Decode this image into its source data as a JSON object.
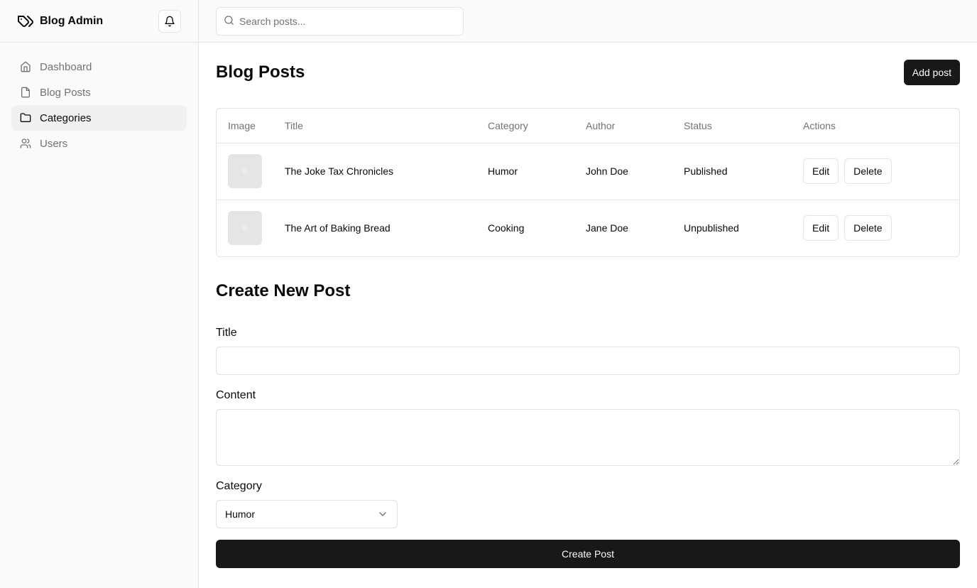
{
  "app": {
    "title": "Blog Admin"
  },
  "sidebar": {
    "items": [
      {
        "label": "Dashboard",
        "icon": "home-icon"
      },
      {
        "label": "Blog Posts",
        "icon": "file-icon"
      },
      {
        "label": "Categories",
        "icon": "folder-icon",
        "active": true
      },
      {
        "label": "Users",
        "icon": "users-icon"
      }
    ]
  },
  "search": {
    "placeholder": "Search posts...",
    "value": ""
  },
  "posts": {
    "title": "Blog Posts",
    "add_label": "Add post",
    "columns": [
      "Image",
      "Title",
      "Category",
      "Author",
      "Status",
      "Actions"
    ],
    "rows": [
      {
        "title": "The Joke Tax Chronicles",
        "category": "Humor",
        "author": "John Doe",
        "status": "Published"
      },
      {
        "title": "The Art of Baking Bread",
        "category": "Cooking",
        "author": "Jane Doe",
        "status": "Unpublished"
      }
    ],
    "edit_label": "Edit",
    "delete_label": "Delete"
  },
  "form": {
    "title": "Create New Post",
    "title_label": "Title",
    "title_value": "",
    "content_label": "Content",
    "content_value": "",
    "category_label": "Category",
    "category_value": "Humor",
    "submit_label": "Create Post"
  },
  "colors": {
    "primary": "#18181b",
    "muted_text": "#71717a",
    "border": "#e4e4e7",
    "sidebar_bg": "#fafafa",
    "active_bg": "#f0f0f2"
  }
}
